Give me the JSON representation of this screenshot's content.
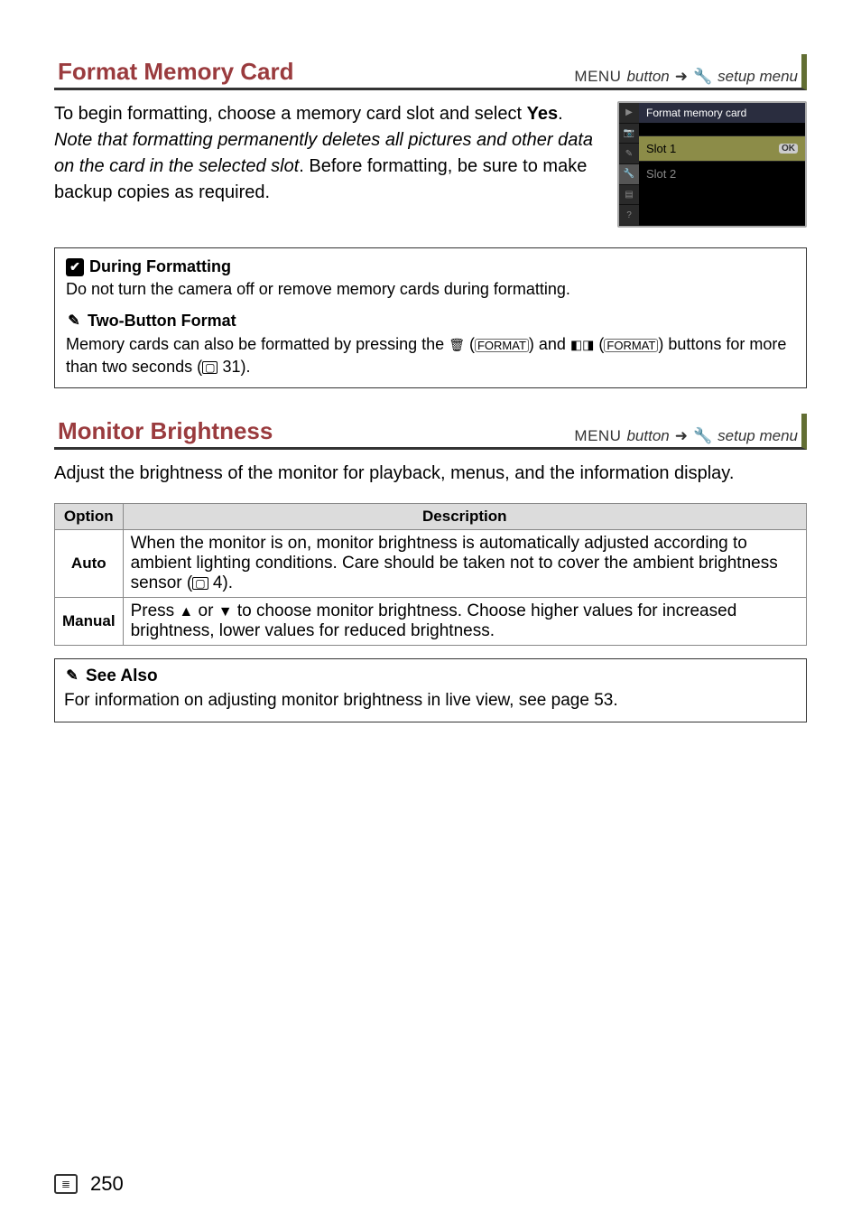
{
  "page_number": "250",
  "sections": {
    "format_card": {
      "title": "Format Memory Card",
      "menu_label": "MENU",
      "button_word": "button",
      "arrow": "➜",
      "setup_menu": "setup menu",
      "intro_prefix": "To begin formatting, choose a memory card slot and select ",
      "intro_yes": "Yes",
      "intro_period": ". ",
      "intro_note": "Note that formatting permanently deletes all pictures and other data on the card in the selected slot",
      "intro_after_note": ".  Before formatting, be sure to make backup copies as required.",
      "camera": {
        "title": "Format memory card",
        "slot1": "Slot 1",
        "slot2": "Slot 2",
        "ok": "OK"
      },
      "callouts": {
        "during_title": "During Formatting",
        "during_body": "Do not turn the camera off or remove memory cards during formatting.",
        "twobtn_title": "Two-Button Format",
        "twobtn_body_1": "Memory cards can also be formatted by pressing the ",
        "twobtn_trash": "🗑",
        "twobtn_format1": "FORMAT",
        "twobtn_body_2": " and ",
        "twobtn_meter": "◧◨",
        "twobtn_format2": "FORMAT",
        "twobtn_body_3": " buttons for more than two seconds (",
        "twobtn_pageref": "31",
        "twobtn_body_4": ")."
      }
    },
    "monitor_brightness": {
      "title": "Monitor Brightness",
      "menu_label": "MENU",
      "button_word": "button",
      "arrow": "➜",
      "setup_menu": "setup menu",
      "intro": "Adjust the brightness of the monitor for playback, menus, and the information display.",
      "table": {
        "col_option": "Option",
        "col_desc": "Description",
        "rows": [
          {
            "label": "Auto",
            "desc_1": "When the monitor is on, monitor brightness is automatically adjusted according to ambient lighting conditions. Care should be taken not to cover the ambient brightness sensor (",
            "pageref": "4",
            "desc_2": ")."
          },
          {
            "label": "Manual",
            "desc_1": "Press ",
            "up": "▲",
            "desc_2": " or ",
            "down": "▼",
            "desc_3": " to choose monitor brightness.  Choose higher values for increased brightness, lower values for reduced brightness."
          }
        ]
      },
      "seealso": {
        "title": "See Also",
        "body": "For information on adjusting monitor brightness in live view, see page 53."
      }
    }
  }
}
